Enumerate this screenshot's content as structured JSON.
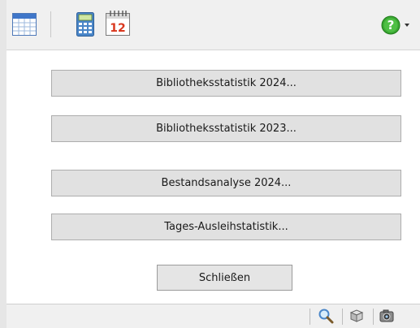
{
  "toolbar": {
    "icons": [
      "table-view-icon",
      "calculator-icon",
      "calendar-icon",
      "help-icon",
      "dropdown-arrow-icon"
    ],
    "calendar_day": "12",
    "help_glyph": "?"
  },
  "actions": {
    "library_stats_2024": "Bibliotheksstatistik 2024...",
    "library_stats_2023": "Bibliotheksstatistik 2023...",
    "inventory_analysis_2024": "Bestandsanalyse 2024...",
    "daily_loan_stats": "Tages-Ausleihstatistik...",
    "close": "Schließen"
  },
  "statusbar": {
    "icons": [
      "magnifier-icon",
      "box-icon",
      "camera-icon"
    ]
  },
  "colors": {
    "button_face": "#e1e1e1",
    "button_border": "#adadad",
    "toolbar_bg": "#f0f0f0",
    "help_green": "#3aa832"
  }
}
